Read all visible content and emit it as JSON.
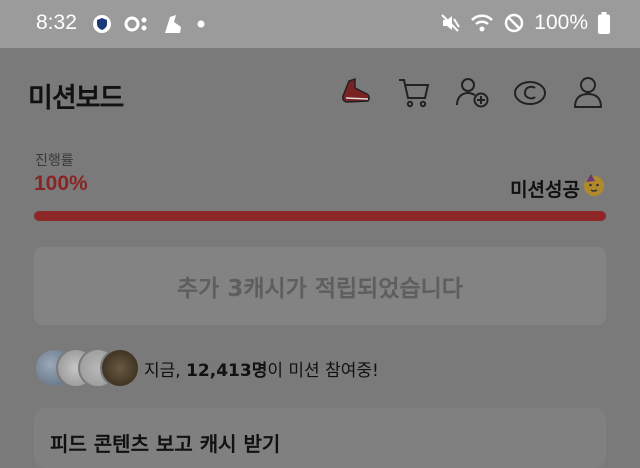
{
  "status_bar": {
    "time": "8:32",
    "battery": "100%",
    "left_icons": [
      "shield-icon",
      "record-icon",
      "sneaker-icon",
      "dot-icon"
    ],
    "right_icons": [
      "mute-icon",
      "wifi-icon",
      "block-icon",
      "battery-icon"
    ]
  },
  "header": {
    "title": "미션보드",
    "icons": [
      "shoe-icon",
      "cart-icon",
      "add-friend-icon",
      "coin-icon",
      "profile-icon"
    ]
  },
  "progress": {
    "label": "진행률",
    "percent_text": "100%",
    "value": 1.0,
    "status": "미션성공",
    "status_emoji": "party-face-icon"
  },
  "notice": {
    "text": "추가 3캐시가 적립되었습니다"
  },
  "participants": {
    "prefix": "지금, ",
    "count": "12,413명",
    "suffix": "이 미션 참여중!"
  },
  "card": {
    "title": "피드 콘텐츠 보고 캐시 받기"
  },
  "colors": {
    "accent": "#8e2828",
    "overlay": "#7a7a7a"
  }
}
